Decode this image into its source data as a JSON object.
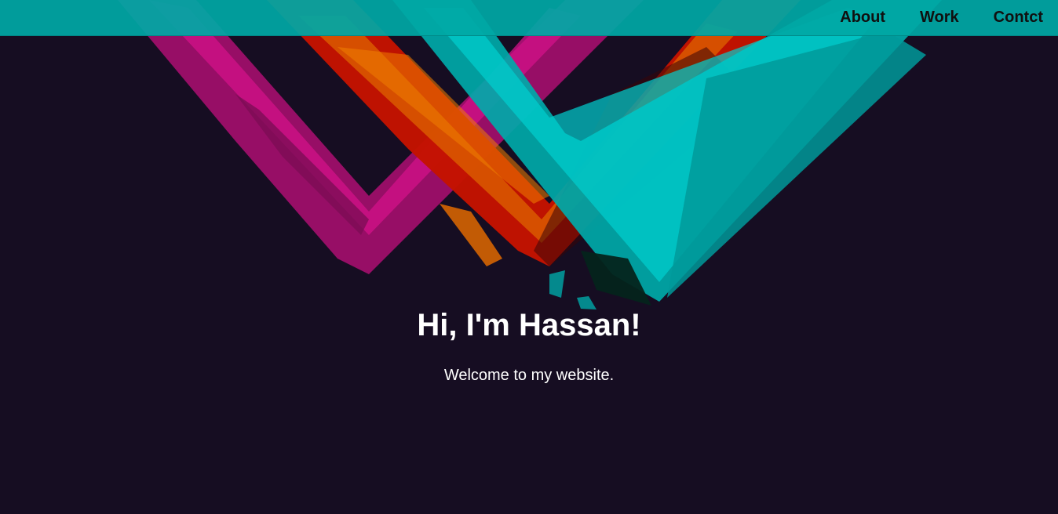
{
  "nav": {
    "links": [
      "About",
      "Work",
      "Contct"
    ]
  },
  "hero": {
    "title": "Hi, I'm Hassan!",
    "subtitle": "Welcome to my website."
  },
  "colors": {
    "background": "#160d22",
    "navbar": "#00a8a5",
    "magenta": "#c0127a",
    "red": "#c41300",
    "orange": "#e06a00",
    "cyan": "#00c8c8"
  }
}
